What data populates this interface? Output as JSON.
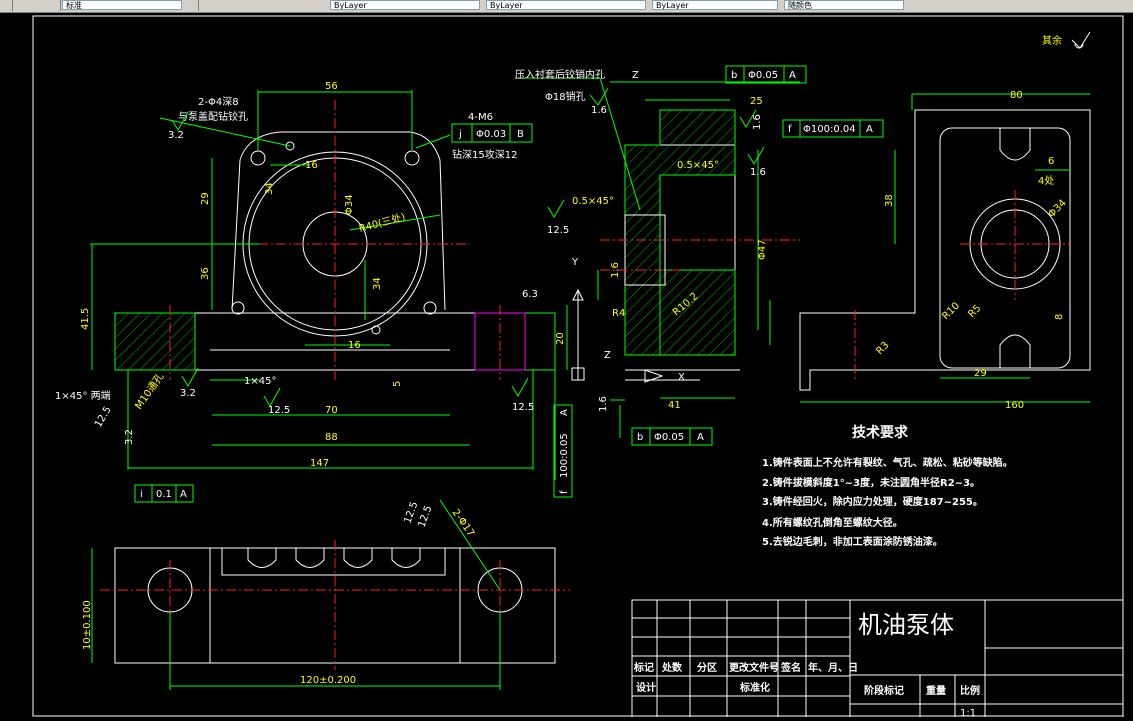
{
  "toolbar": {
    "fields": [
      "标准",
      "ByLayer",
      "ByLayer",
      "ByLayer",
      "随颜色"
    ]
  },
  "drawing": {
    "surface_note": "其余",
    "front_view": {
      "dim_top": "56",
      "holes_note_1": "2-Φ4深8",
      "holes_note_2": "与泵盖配钻铰孔",
      "rough_top": "3.2",
      "tap_note_1": "4-M6",
      "tap_note_2": "钻深15攻深12",
      "tol_symbol": "j",
      "tol_value": "Φ0.03",
      "tol_datum": "B",
      "dim_16_top": "16",
      "dim_34_top": "34",
      "dim_29": "29",
      "dim_36": "36",
      "dim_41_5": "41.5",
      "dim_34_right": "34",
      "dim_16_bot": "16",
      "radius_note": "R40(三处)",
      "bore_dim": "Φ34",
      "dim_6_3": "6.3",
      "dim_20": "20",
      "rough_12_5_a": "12.5",
      "rough_12_5_b": "12.5",
      "rough_3_2_b": "3.2",
      "chamfer_note": "1×45°",
      "chamfer_both": "1×45° 两端",
      "dim_70": "70",
      "dim_88": "88",
      "dim_147": "147",
      "dim_5": "5",
      "rough_12_5_c": "12.5",
      "rough_3_2_c": "3.2",
      "tol_i_symbol": "i",
      "tol_i_value": "0.1",
      "tol_i_datum": "A",
      "m10_note": "M10通孔"
    },
    "section_view": {
      "press_note": "压入衬套后铰销内孔",
      "bore_note": "Φ18销孔",
      "rough_1_6_a": "1.6",
      "tol_b_symbol": "b",
      "tol_b_value": "Φ0.05",
      "tol_b_datum": "A",
      "dim_25": "25",
      "rough_1_6_b": "1.6",
      "tol_f_symbol": "f",
      "tol_f_value": "Φ100:0.04",
      "tol_f_datum": "A",
      "rough_1_6_c": "1.6",
      "chamfer_1": "0.5×45°",
      "chamfer_2": "0.5×45°",
      "rough_12_5": "12.5",
      "dim_phi": "Φ47",
      "rough_1_6_d": "1.6",
      "r4": "R4",
      "r10_2": "R10.2",
      "dim_41": "41",
      "rough_1_6_e": "1.6",
      "tol2_symbol": "b",
      "tol2_value": "Φ0.05",
      "tol2_datum": "A",
      "vtol_symbol": "f",
      "vtol_value": "100:0.05",
      "vtol_datum": "A",
      "rough_12_5_d": "12.5",
      "label_z1": "Z",
      "label_z2": "Z",
      "label_y": "Y",
      "label_x": "X"
    },
    "side_view": {
      "dim_80": "80",
      "dim_6": "6",
      "four_places": "4处",
      "dim_38": "38",
      "phi_34": "Φ34",
      "r10": "R10",
      "r5": "R5",
      "r3": "R3",
      "dim_8": "8",
      "dim_29": "29",
      "dim_160": "160"
    },
    "bottom_view": {
      "dim_120": "120±0.200",
      "dim_10": "10±0.100",
      "holes": "2-Φ17",
      "rough": "12.5"
    },
    "tech_req": {
      "title": "技术要求",
      "items": [
        "1.铸件表面上不允许有裂纹、气孔、疏松、粘砂等缺陷。",
        "2.铸件拔模斜度1°~3度，未注圆角半径R2~3。",
        "3.铸件经回火，除内应力处理，硬度187~255。",
        "4.所有螺纹孔倒角至螺纹大径。",
        "5.去锐边毛刺，非加工表面涂防锈油漆。"
      ]
    },
    "title_block": {
      "part_name": "机油泵体",
      "headers": [
        "标记",
        "处数",
        "分区",
        "更改文件号",
        "签名",
        "年、月、日"
      ],
      "row2": [
        "设计",
        "标准化"
      ],
      "right_headers": [
        "阶段标记",
        "重量",
        "比例"
      ],
      "scale": "1:1"
    }
  }
}
